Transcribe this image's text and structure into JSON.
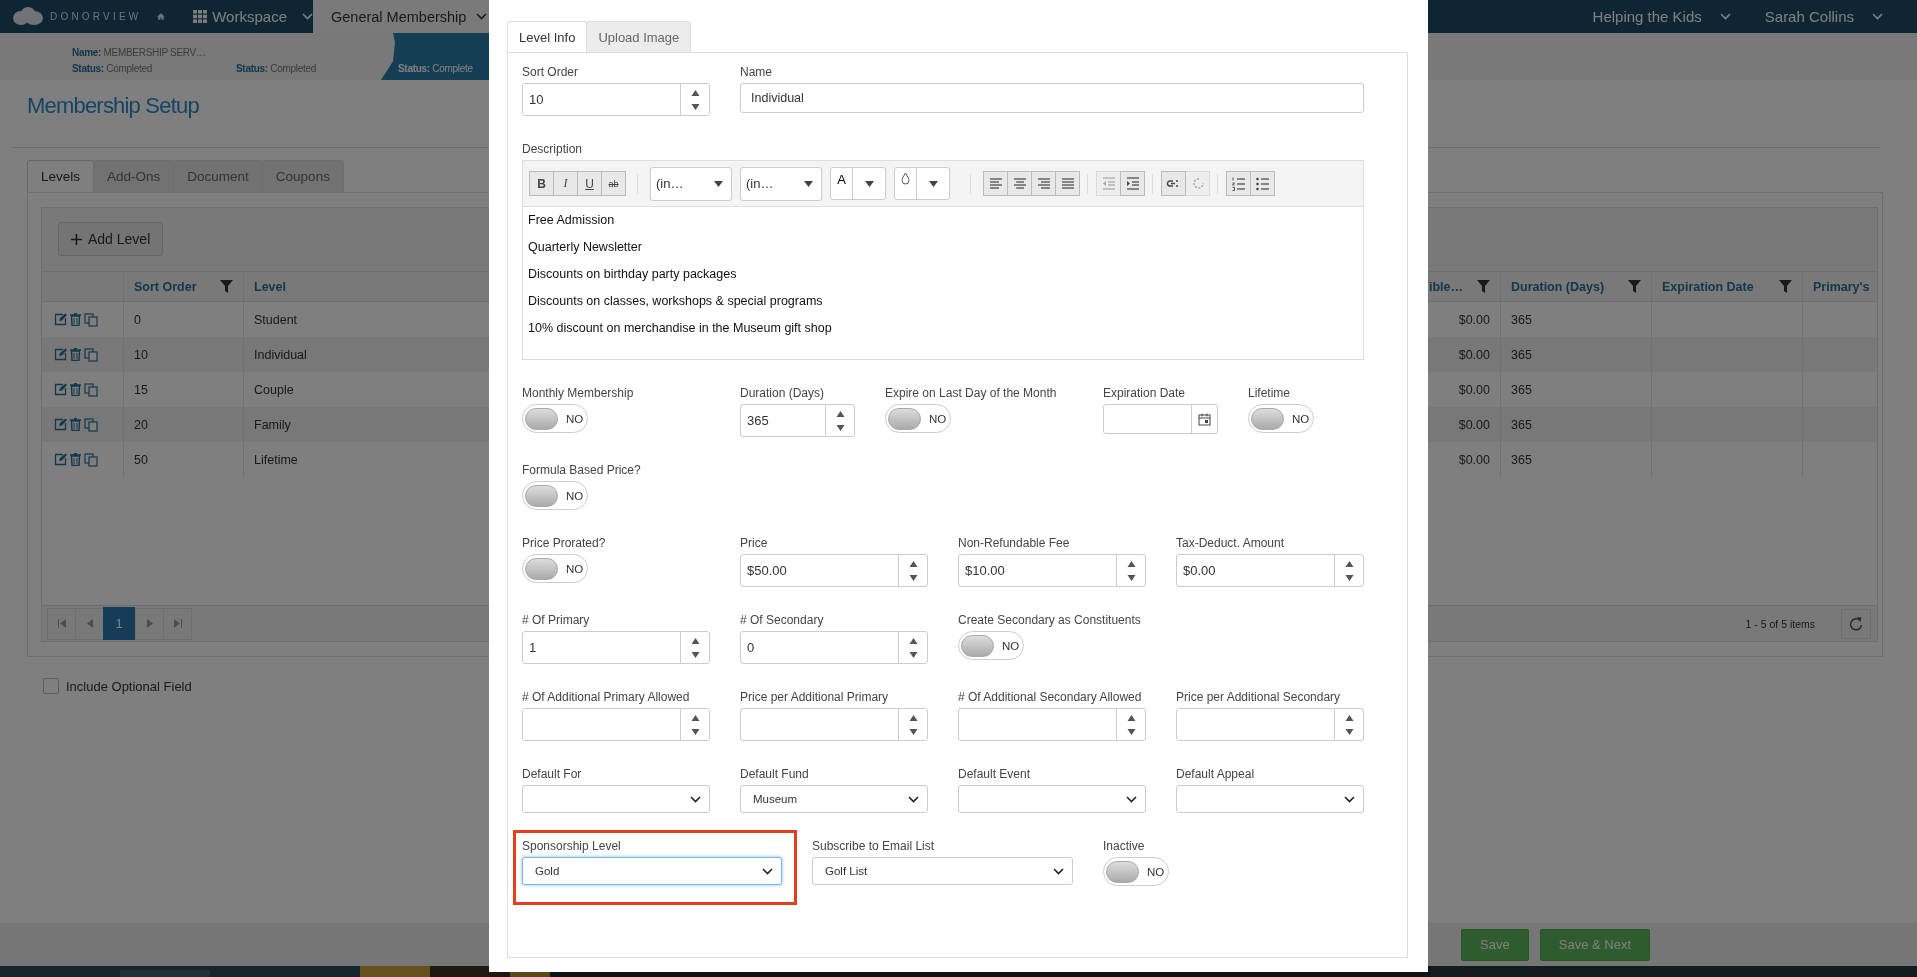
{
  "header": {
    "brand": "DONORVIEW",
    "workspace": "Workspace",
    "module": "General Membership",
    "organization": "Helping the Kids",
    "user": "Sarah Collins"
  },
  "progress_steps": [
    {
      "name_label": "Name:",
      "name": "MEMBERSHIP SERV…",
      "status_label": "Status:",
      "status": "Completed",
      "selected": false
    },
    {
      "status_label": "Status:",
      "status": "Completed",
      "selected": false
    },
    {
      "status_label": "Status:",
      "status": "Complete",
      "selected": true
    }
  ],
  "page_title": "Membership Setup",
  "tabs": [
    {
      "label": "Levels",
      "selected": true
    },
    {
      "label": "Add-Ons",
      "selected": false
    },
    {
      "label": "Document",
      "selected": false
    },
    {
      "label": "Coupons",
      "selected": false
    }
  ],
  "add_button": "Add Level",
  "table": {
    "columns": [
      {
        "label": "Sort Order",
        "filterable": true
      },
      {
        "label": "Level"
      },
      {
        "label": "ible…",
        "filterable": true
      },
      {
        "label": "Duration (Days)",
        "filterable": true
      },
      {
        "label": "Expiration Date",
        "filterable": true
      },
      {
        "label": "Primary's"
      }
    ],
    "rows": [
      {
        "sort_order": "0",
        "level": "Student",
        "column_3": "$0.00",
        "duration": "365"
      },
      {
        "sort_order": "10",
        "level": "Individual",
        "column_3": "$0.00",
        "duration": "365"
      },
      {
        "sort_order": "15",
        "level": "Couple",
        "column_3": "$0.00",
        "duration": "365"
      },
      {
        "sort_order": "20",
        "level": "Family",
        "column_3": "$0.00",
        "duration": "365"
      },
      {
        "sort_order": "50",
        "level": "Lifetime",
        "column_3": "$0.00",
        "duration": "365"
      }
    ]
  },
  "pager": {
    "pages": [
      {
        "label": "1",
        "selected": true
      }
    ],
    "summary": "1 - 5 of 5 items"
  },
  "optional_field": {
    "label": "Include Optional Field",
    "checked": false
  },
  "footer_buttons": [
    {
      "label": "Save"
    },
    {
      "label": "Save & Next"
    }
  ],
  "modal": {
    "tabs": [
      {
        "label": "Level Info",
        "selected": true
      },
      {
        "label": "Upload Image",
        "selected": false
      }
    ],
    "rows": [
      {
        "fields": [
          {
            "kind": "number",
            "label": "Sort Order",
            "value": "10"
          },
          {
            "kind": "text",
            "label": "Name",
            "value": "Individual"
          }
        ]
      },
      {
        "fields": [
          {
            "kind": "editor",
            "label": "Description",
            "toolbar": {
              "format_buttons": [
                {
                  "kind": "bold",
                  "label": "B"
                },
                {
                  "kind": "italic",
                  "label": "I"
                },
                {
                  "kind": "underline",
                  "label": "U"
                },
                {
                  "kind": "strike",
                  "label": "ab"
                }
              ],
              "font_menus": [
                "(in…",
                "(in…"
              ],
              "color_menus": [
                {
                  "kind": "text",
                  "label": "A"
                },
                {
                  "kind": "fill"
                }
              ],
              "button_groups": [
                {
                  "buttons": [
                    {
                      "kind": "left",
                      "disabled": false
                    },
                    {
                      "kind": "center",
                      "disabled": false
                    },
                    {
                      "kind": "right",
                      "disabled": false
                    },
                    {
                      "kind": "justify",
                      "disabled": false
                    }
                  ]
                },
                {
                  "buttons": [
                    {
                      "kind": "outdent",
                      "disabled": true
                    },
                    {
                      "kind": "indent",
                      "disabled": false
                    }
                  ]
                },
                {
                  "buttons": [
                    {
                      "kind": "link",
                      "disabled": false
                    },
                    {
                      "kind": "unlink",
                      "disabled": true
                    }
                  ]
                },
                {
                  "buttons": [
                    {
                      "kind": "numbered",
                      "disabled": false
                    },
                    {
                      "kind": "bulleted",
                      "disabled": false
                    }
                  ]
                }
              ]
            },
            "lines": [
              "Free Admission",
              "Quarterly Newsletter",
              "Discounts on birthday party packages",
              "Discounts on classes, workshops & special programs",
              "10% discount on merchandise in the Museum gift shop"
            ]
          }
        ]
      },
      {
        "fields": [
          {
            "kind": "toggle",
            "label": "Monthly Membership",
            "on": false,
            "state_text": "NO"
          },
          {
            "kind": "number",
            "label": "Duration (Days)",
            "value": "365"
          },
          {
            "kind": "toggle",
            "label": "Expire on Last Day of the Month",
            "on": false,
            "state_text": "NO"
          },
          {
            "kind": "date",
            "label": "Expiration Date"
          },
          {
            "kind": "toggle",
            "label": "Lifetime",
            "on": false,
            "state_text": "NO"
          }
        ]
      },
      {
        "fields": [
          {
            "kind": "toggle",
            "label": "Formula Based Price?",
            "on": false,
            "state_text": "NO"
          }
        ]
      },
      {
        "fields": [
          {
            "kind": "toggle",
            "label": "Price Prorated?",
            "on": false,
            "state_text": "NO"
          },
          {
            "kind": "number",
            "label": "Price",
            "value": "$50.00"
          },
          {
            "kind": "number",
            "label": "Non-Refundable Fee",
            "value": "$10.00"
          },
          {
            "kind": "number",
            "label": "Tax-Deduct. Amount",
            "value": "$0.00"
          }
        ]
      },
      {
        "fields": [
          {
            "kind": "number",
            "label": "# Of Primary",
            "value": "1"
          },
          {
            "kind": "number",
            "label": "# Of Secondary",
            "value": "0"
          },
          {
            "kind": "toggle",
            "label": "Create Secondary as Constituents",
            "on": false,
            "state_text": "NO"
          }
        ]
      },
      {
        "fields": [
          {
            "kind": "number",
            "label": "# Of Additional Primary Allowed"
          },
          {
            "kind": "number",
            "label": "Price per Additional Primary"
          },
          {
            "kind": "number",
            "label": "# Of Additional Secondary Allowed"
          },
          {
            "kind": "number",
            "label": "Price per Additional Secondary"
          }
        ]
      },
      {
        "fields": [
          {
            "kind": "select",
            "label": "Default For"
          },
          {
            "kind": "select",
            "label": "Default Fund",
            "value": "Museum"
          },
          {
            "kind": "select",
            "label": "Default Event"
          },
          {
            "kind": "select",
            "label": "Default Appeal"
          }
        ]
      },
      {
        "fields": [
          {
            "kind": "select",
            "label": "Sponsorship Level",
            "value": "Gold",
            "highlighted": true
          },
          {
            "kind": "select",
            "label": "Subscribe to Email List",
            "value": "Golf List"
          },
          {
            "kind": "toggle",
            "label": "Inactive",
            "on": false,
            "state_text": "NO"
          }
        ]
      }
    ]
  }
}
